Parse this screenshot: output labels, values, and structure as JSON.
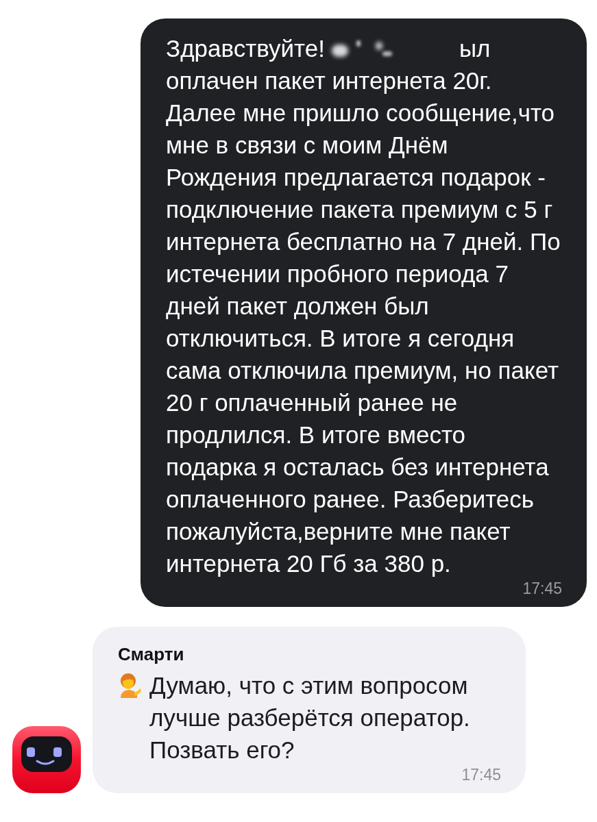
{
  "chat": {
    "messages": [
      {
        "kind": "outgoing",
        "lead": "Здравствуйте!",
        "redacted": true,
        "lead_end": "ыл",
        "text": "оплачен пакет интернета 20г. Далее мне пришло сообщение,что мне в связи с моим Днём Рождения предлагается подарок - подключение пакета премиум с 5 г интернета бесплатно на 7 дней. По истечении пробного периода 7 дней пакет должен был отключиться. В итоге я сегодня сама отключила премиум, но пакет 20 г оплаченный ранее не продлился. В итоге вместо подарка я осталась без интернета оплаченного ранее. Разберитесь пожалуйста,верните мне пакет интернета 20 Гб за 380 р.",
        "time": "17:45"
      },
      {
        "kind": "incoming",
        "sender": "Смарти",
        "text": "Думаю, что с этим вопросом лучше разберётся оператор. Позвать его?",
        "time": "17:45"
      }
    ]
  }
}
